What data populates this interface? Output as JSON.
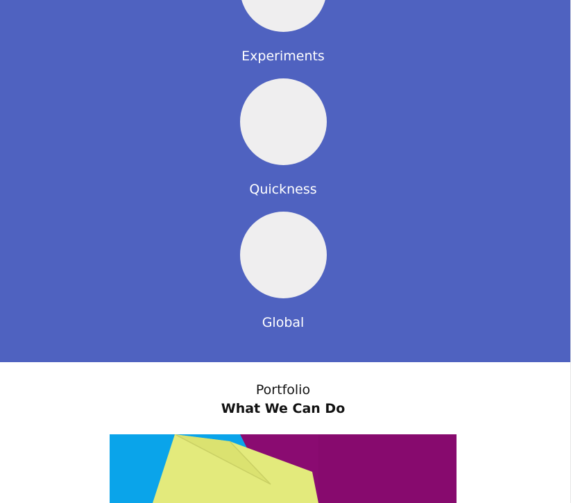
{
  "features": {
    "items": [
      {
        "label": "Experiments",
        "icon": "placeholder-circle-icon"
      },
      {
        "label": "Quickness",
        "icon": "placeholder-circle-icon"
      },
      {
        "label": "Global",
        "icon": "placeholder-circle-icon"
      }
    ],
    "background_color": "#4f62c0",
    "circle_color": "#efeeef"
  },
  "portfolio": {
    "eyebrow": "Portfolio",
    "title": "What We Can Do",
    "image_colors": {
      "blue": "#0aa4ea",
      "magenta": "#8a0b71",
      "yellow": "#e3ea7c"
    }
  }
}
